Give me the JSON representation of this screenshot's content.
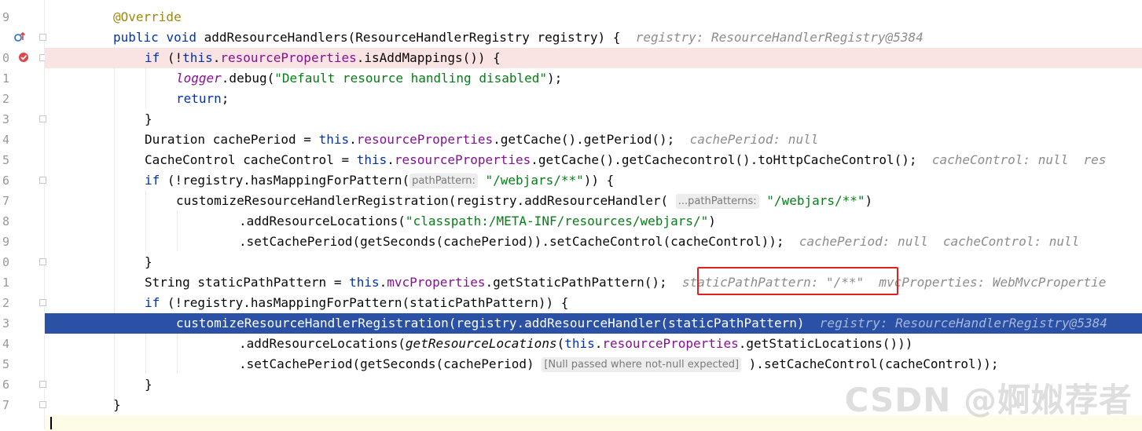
{
  "gutter": {
    "line_numbers": [
      "9",
      "0",
      "1",
      "2",
      "3",
      "4",
      "5",
      "6",
      "7",
      "8",
      "9",
      "0",
      "1",
      "2",
      "3",
      "4",
      "5",
      "6",
      "7"
    ]
  },
  "code": {
    "l0": "@Override",
    "l1_kw1": "public",
    "l1_kw2": "void",
    "l1_rest": "addResourceHandlers(ResourceHandlerRegistry registry) {",
    "l1_hint": "registry: ResourceHandlerRegistry@5384",
    "l2_kw": "if",
    "l2_a": " (!",
    "l2_this": "this",
    "l2_dot": ".",
    "l2_field": "resourceProperties",
    "l2_rest": ".isAddMappings()) {",
    "l3_logger": "logger",
    "l3_mid": ".debug(",
    "l3_str": "\"Default resource handling disabled\"",
    "l3_end": ");",
    "l4_kw": "return",
    "l4_end": ";",
    "l5": "}",
    "l6_a": "Duration cachePeriod = ",
    "l6_this": "this",
    "l6_field": "resourceProperties",
    "l6_rest": ".getCache().getPeriod();",
    "l6_hint": "cachePeriod: null",
    "l7_a": "CacheControl cacheControl = ",
    "l7_this": "this",
    "l7_field": "resourceProperties",
    "l7_rest": ".getCache().getCachecontrol().toHttpCacheControl();",
    "l7_hint": "cacheControl: null  res",
    "l8_kw": "if",
    "l8_a": " (!registry.hasMappingForPattern(",
    "l8_inlay": "pathPattern:",
    "l8_str": "\"/webjars/**\"",
    "l8_end": ")) {",
    "l9_a": "customizeResourceHandlerRegistration(registry.addResourceHandler(",
    "l9_inlay": "...pathPatterns:",
    "l9_str": "\"/webjars/**\"",
    "l9_end": ")",
    "l10_a": ".addResourceLocations(",
    "l10_str": "\"classpath:/META-INF/resources/webjars/\"",
    "l10_end": ")",
    "l11_a": ".setCachePeriod(getSeconds(cachePeriod)).setCacheControl(cacheControl));",
    "l11_hint": "cachePeriod: null  cacheControl: null",
    "l12": "}",
    "l13_a": "String staticPathPattern = ",
    "l13_this": "this",
    "l13_field": "mvcProperties",
    "l13_rest": ".getStaticPathPattern();",
    "l13_hint_boxed": "staticPathPattern: \"/**\"",
    "l13_hint2": "mvcProperties: WebMvcPropertie",
    "l14_kw": "if",
    "l14_a": " (!registry.hasMappingForPattern(staticPathPattern)) {",
    "l15_a": "customizeResourceHandlerRegistration(registry.addResourceHandler(staticPathPattern)",
    "l15_hint": "registry: ResourceHandlerRegistry@5384",
    "l16_a": ".addResourceLocations(",
    "l16_it": "getResourceLocations",
    "l16_b": "(",
    "l16_this": "this",
    "l16_field": "resourceProperties",
    "l16_rest": ".getStaticLocations()))",
    "l17_a": ".setCachePeriod(getSeconds(cachePeriod)",
    "l17_inlay": "[Null passed where not-null expected]",
    "l17_rest": ").setCacheControl(cacheControl));",
    "l18": "}",
    "l19": "}"
  },
  "watermark": "CSDN @婀娰荐者",
  "colors": {
    "keyword": "#0033b3",
    "field": "#871094",
    "string": "#067d17",
    "annotation": "#9e880d",
    "hint": "#8c8c8c",
    "current_line": "#2a51a6",
    "breakpoint_line": "#fae3e3",
    "highlight_box": "#e02020"
  },
  "icons": [
    "override-up-icon",
    "breakpoint-icon"
  ]
}
